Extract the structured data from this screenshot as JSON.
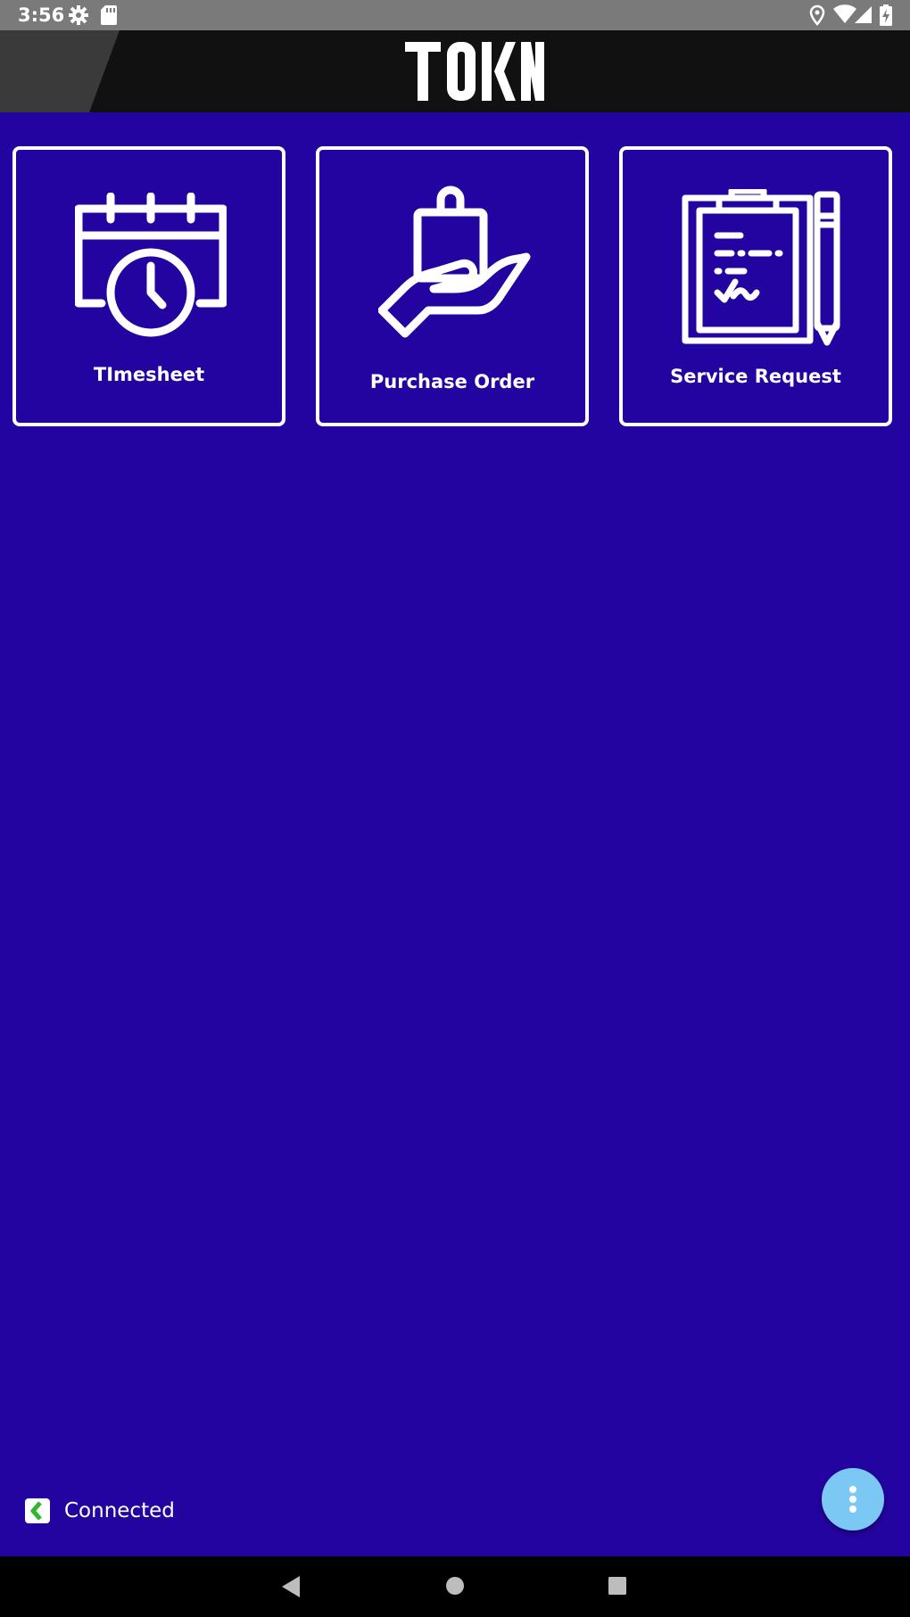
{
  "status_bar": {
    "time": "3:56",
    "icons": [
      "settings-icon",
      "sd-card-icon",
      "location-icon",
      "wifi-icon",
      "signal-icon",
      "battery-charging-icon"
    ]
  },
  "header": {
    "logo_text": "TOKN",
    "background": "#111111"
  },
  "tiles": [
    {
      "label": "TImesheet",
      "icon": "calendar-clock-icon"
    },
    {
      "label": "Purchase Order",
      "icon": "hand-shopping-bag-icon"
    },
    {
      "label": "Service Request",
      "icon": "clipboard-pencil-icon"
    }
  ],
  "footer": {
    "connection_status": "Connected",
    "connection_icon": "connection-status-icon"
  },
  "fab": {
    "icon": "more-vertical-icon"
  },
  "nav_bar": {
    "icons": [
      "back-icon",
      "home-icon",
      "recents-icon"
    ]
  },
  "colors": {
    "background": "#2304a0",
    "tile_border": "#ffffff",
    "fab": "#7cc8f5",
    "connected_green": "#2fb82f"
  }
}
